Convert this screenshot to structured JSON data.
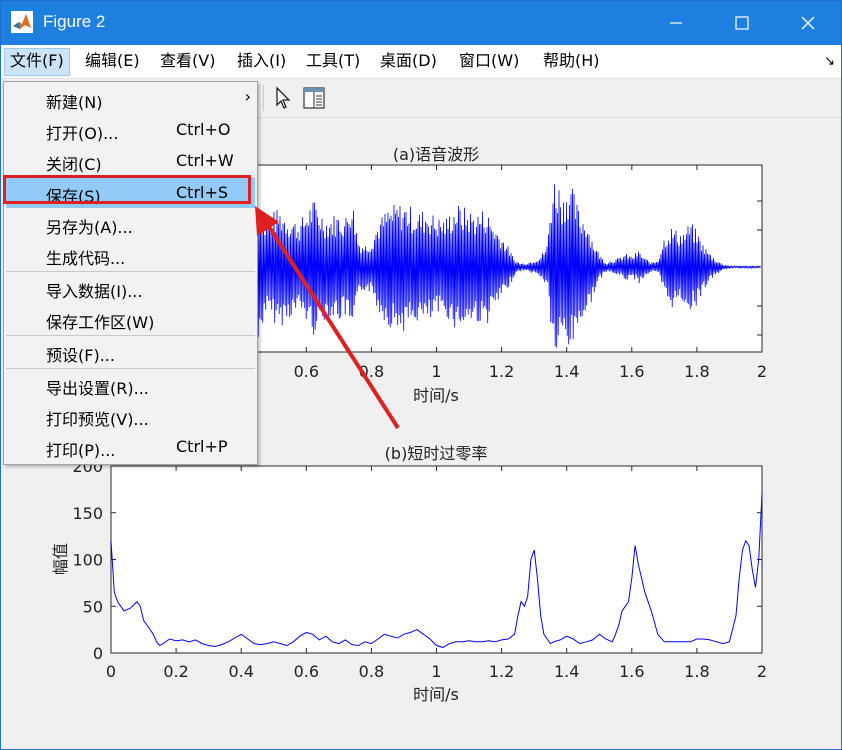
{
  "window": {
    "title": "Figure 2",
    "accent": "#1f7fe0"
  },
  "menubar": [
    {
      "label": "文件(F)"
    },
    {
      "label": "编辑(E)"
    },
    {
      "label": "查看(V)"
    },
    {
      "label": "插入(I)"
    },
    {
      "label": "工具(T)"
    },
    {
      "label": "桌面(D)"
    },
    {
      "label": "窗口(W)"
    },
    {
      "label": "帮助(H)"
    }
  ],
  "file_menu": {
    "items": [
      {
        "label": "新建(N)",
        "shortcut": "",
        "submenu": true
      },
      {
        "label": "打开(O)...",
        "shortcut": "Ctrl+O"
      },
      {
        "label": "关闭(C)",
        "shortcut": "Ctrl+W"
      },
      {
        "label": "保存(S)",
        "shortcut": "Ctrl+S",
        "selected": true
      },
      {
        "label": "另存为(A)...",
        "shortcut": ""
      },
      {
        "label": "生成代码...",
        "shortcut": ""
      },
      {
        "label": "导入数据(I)...",
        "shortcut": ""
      },
      {
        "label": "保存工作区(W)",
        "shortcut": ""
      },
      {
        "label": "预设(F)...",
        "shortcut": ""
      },
      {
        "label": "导出设置(R)...",
        "shortcut": ""
      },
      {
        "label": "打印预览(V)...",
        "shortcut": ""
      },
      {
        "label": "打印(P)...",
        "shortcut": "Ctrl+P"
      }
    ],
    "highlight_color": "#e02020"
  },
  "toolbar": {
    "icons": [
      "pointer-icon",
      "property-inspector-icon"
    ]
  },
  "chart_data": [
    {
      "type": "line",
      "title": "(a)语音波形",
      "xlabel": "时间/s",
      "ylabel": "",
      "xlim": [
        0,
        2
      ],
      "xticks": [
        0.6,
        0.8,
        1,
        1.2,
        1.4,
        1.6,
        1.8,
        2
      ],
      "xtick_labels": [
        "0.6",
        "0.8",
        "1",
        "1.2",
        "1.4",
        "1.6",
        "1.8",
        "2"
      ],
      "series": [
        {
          "color": "#0000ff",
          "envelope": {
            "t": [
              0.45,
              0.47,
              0.49,
              0.52,
              0.55,
              0.58,
              0.62,
              0.66,
              0.7,
              0.72,
              0.74,
              0.76,
              0.78,
              0.8,
              0.82,
              0.85,
              0.88,
              0.91,
              0.94,
              0.97,
              1.0,
              1.03,
              1.06,
              1.09,
              1.12,
              1.15,
              1.18,
              1.21,
              1.24,
              1.26,
              1.28,
              1.3,
              1.32,
              1.34,
              1.35,
              1.36,
              1.37,
              1.38,
              1.39,
              1.4,
              1.42,
              1.44,
              1.46,
              1.48,
              1.5,
              1.52,
              1.54,
              1.56,
              1.58,
              1.6,
              1.62,
              1.64,
              1.66,
              1.68,
              1.7,
              1.72,
              1.74,
              1.76,
              1.78,
              1.8,
              1.82,
              1.84,
              1.86,
              1.88,
              1.9,
              1.93,
              1.96,
              2.0
            ],
            "amp": [
              0.95,
              0.5,
              0.6,
              0.65,
              0.55,
              0.5,
              0.75,
              0.55,
              0.6,
              0.55,
              0.8,
              0.3,
              0.25,
              0.3,
              0.5,
              0.65,
              0.7,
              0.7,
              0.6,
              0.65,
              0.55,
              0.55,
              0.7,
              0.65,
              0.6,
              0.65,
              0.45,
              0.3,
              0.08,
              0.04,
              0.05,
              0.08,
              0.12,
              0.25,
              0.7,
              1.0,
              1.0,
              0.9,
              0.8,
              0.95,
              0.85,
              0.6,
              0.55,
              0.3,
              0.15,
              0.05,
              0.08,
              0.1,
              0.15,
              0.12,
              0.18,
              0.1,
              0.05,
              0.08,
              0.35,
              0.45,
              0.4,
              0.4,
              0.5,
              0.4,
              0.25,
              0.15,
              0.08,
              0.03,
              0.01,
              0.01,
              0.01,
              0.01
            ]
          }
        }
      ]
    },
    {
      "type": "line",
      "title": "(b)短时过零率",
      "xlabel": "时间/s",
      "ylabel": "幅值",
      "xlim": [
        0,
        2
      ],
      "ylim": [
        0,
        200
      ],
      "xticks": [
        0,
        0.2,
        0.4,
        0.6,
        0.8,
        1,
        1.2,
        1.4,
        1.6,
        1.8,
        2
      ],
      "xtick_labels": [
        "0",
        "0.2",
        "0.4",
        "0.6",
        "0.8",
        "1",
        "1.2",
        "1.4",
        "1.6",
        "1.8",
        "2"
      ],
      "yticks": [
        0,
        50,
        100,
        150,
        200
      ],
      "ytick_labels": [
        "0",
        "50",
        "100",
        "150",
        "200"
      ],
      "series": [
        {
          "color": "#0000ff",
          "x": [
            0.0,
            0.01,
            0.02,
            0.03,
            0.04,
            0.06,
            0.08,
            0.09,
            0.1,
            0.11,
            0.12,
            0.13,
            0.14,
            0.15,
            0.16,
            0.18,
            0.2,
            0.22,
            0.24,
            0.26,
            0.28,
            0.3,
            0.32,
            0.34,
            0.36,
            0.38,
            0.4,
            0.42,
            0.44,
            0.46,
            0.48,
            0.5,
            0.52,
            0.54,
            0.56,
            0.58,
            0.6,
            0.62,
            0.64,
            0.66,
            0.68,
            0.7,
            0.72,
            0.74,
            0.76,
            0.78,
            0.8,
            0.82,
            0.84,
            0.86,
            0.88,
            0.9,
            0.92,
            0.94,
            0.96,
            0.98,
            1.0,
            1.02,
            1.04,
            1.06,
            1.08,
            1.1,
            1.12,
            1.14,
            1.16,
            1.18,
            1.2,
            1.22,
            1.24,
            1.25,
            1.26,
            1.27,
            1.28,
            1.29,
            1.3,
            1.31,
            1.32,
            1.33,
            1.34,
            1.35,
            1.36,
            1.38,
            1.4,
            1.42,
            1.44,
            1.46,
            1.48,
            1.5,
            1.52,
            1.54,
            1.55,
            1.56,
            1.57,
            1.58,
            1.59,
            1.6,
            1.61,
            1.62,
            1.63,
            1.64,
            1.65,
            1.66,
            1.68,
            1.7,
            1.72,
            1.74,
            1.76,
            1.78,
            1.8,
            1.82,
            1.84,
            1.86,
            1.88,
            1.9,
            1.92,
            1.93,
            1.94,
            1.95,
            1.96,
            1.97,
            1.98,
            1.99,
            2.0
          ],
          "y": [
            120,
            65,
            55,
            50,
            45,
            48,
            55,
            50,
            35,
            30,
            25,
            20,
            12,
            8,
            10,
            15,
            13,
            14,
            12,
            14,
            10,
            8,
            7,
            9,
            12,
            16,
            20,
            15,
            10,
            9,
            10,
            12,
            10,
            8,
            12,
            18,
            22,
            20,
            14,
            18,
            12,
            10,
            14,
            9,
            8,
            12,
            10,
            15,
            20,
            18,
            16,
            20,
            22,
            25,
            20,
            15,
            8,
            6,
            10,
            12,
            12,
            13,
            12,
            12,
            13,
            12,
            14,
            15,
            20,
            40,
            55,
            50,
            60,
            100,
            110,
            80,
            40,
            20,
            15,
            10,
            12,
            14,
            18,
            15,
            10,
            12,
            14,
            20,
            15,
            12,
            20,
            30,
            45,
            50,
            55,
            80,
            115,
            95,
            80,
            65,
            55,
            45,
            20,
            12,
            12,
            12,
            12,
            12,
            15,
            15,
            14,
            12,
            10,
            12,
            40,
            80,
            110,
            120,
            115,
            90,
            70,
            100,
            170
          ]
        }
      ]
    }
  ]
}
